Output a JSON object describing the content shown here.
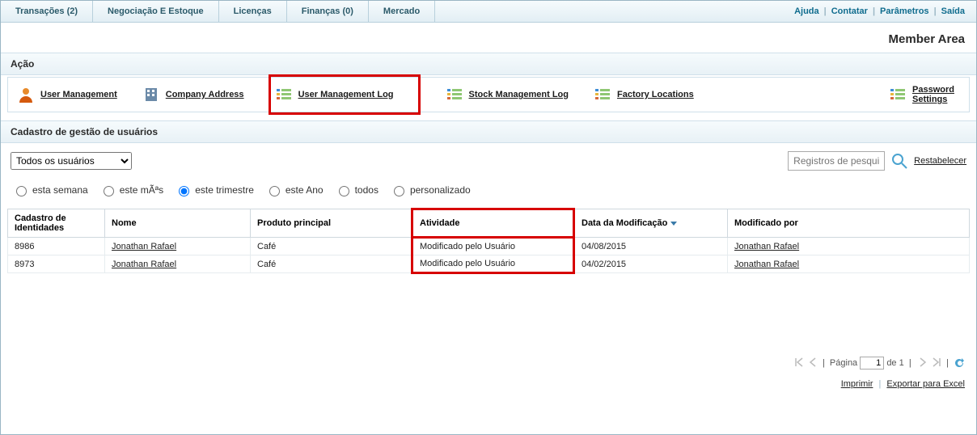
{
  "nav": {
    "tabs": [
      {
        "label": "Transações (2)"
      },
      {
        "label": "Negociação E Estoque"
      },
      {
        "label": "Licenças"
      },
      {
        "label": "Finanças (0)"
      },
      {
        "label": "Mercado"
      }
    ],
    "links": {
      "help": "Ajuda",
      "contact": "Contatar",
      "params": "Parâmetros",
      "exit": "Saída"
    },
    "memberArea": "Member Area"
  },
  "actionHeader": "Ação",
  "actions": {
    "userMgmt": "User Management",
    "companyAddr": "Company Address",
    "userMgmtLog": "User Management Log",
    "stockMgmtLog": "Stock Management Log",
    "factoryLoc": "Factory Locations",
    "pwdSettings": "Password Settings"
  },
  "subHeader": "Cadastro de gestão de usuários",
  "filter": {
    "dropdown": "Todos os usuários",
    "searchPlaceholder": "Registros de pesquisa",
    "reset": "Restabelecer"
  },
  "radios": {
    "week": "esta semana",
    "month": "este mÃªs",
    "quarter": "este trimestre",
    "year": "este Ano",
    "all": "todos",
    "custom": "personalizado",
    "selected": "quarter"
  },
  "table": {
    "headers": {
      "id": "Cadastro de Identidades",
      "name": "Nome",
      "product": "Produto principal",
      "activity": "Atividade",
      "modDate": "Data da Modificação",
      "modBy": "Modificado por"
    },
    "rows": [
      {
        "id": "8986",
        "name": "Jonathan Rafael",
        "product": "Café",
        "activity": "Modificado pelo Usuário",
        "modDate": "04/08/2015",
        "modBy": "Jonathan Rafael"
      },
      {
        "id": "8973",
        "name": "Jonathan Rafael",
        "product": "Café",
        "activity": "Modificado pelo Usuário",
        "modDate": "04/02/2015",
        "modBy": "Jonathan Rafael"
      }
    ]
  },
  "pager": {
    "pageLabel": "Página",
    "ofLabel": "de",
    "current": "1",
    "total": "1"
  },
  "footer": {
    "print": "Imprimir",
    "export": "Exportar para Excel"
  }
}
